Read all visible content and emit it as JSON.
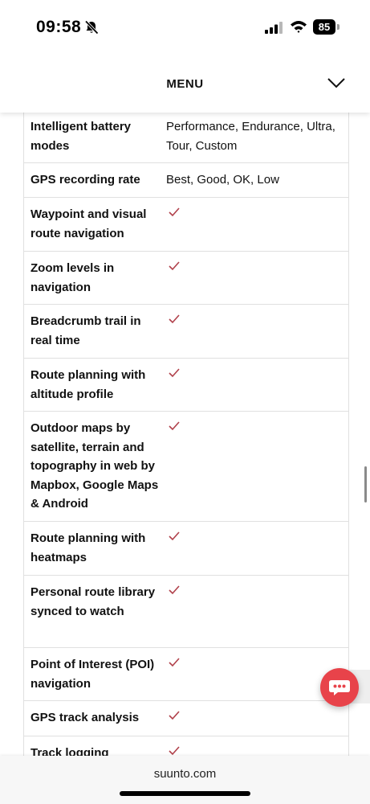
{
  "status_bar": {
    "time": "09:58",
    "battery_level": "85",
    "icons": [
      "bell-muted-icon",
      "cellular-signal-icon",
      "wifi-icon",
      "battery-icon"
    ]
  },
  "menu": {
    "label": "MENU",
    "toggle_icon": "chevron-down-icon"
  },
  "features": [
    {
      "label": "Intelligent battery modes",
      "value": "Performance, Endurance, Ultra, Tour, Custom",
      "check": false
    },
    {
      "label": "GPS recording rate",
      "value": "Best, Good, OK, Low",
      "check": false
    },
    {
      "label": "Waypoint and visual route navigation",
      "value": "",
      "check": true
    },
    {
      "label": "Zoom levels in navigation",
      "value": "",
      "check": true
    },
    {
      "label": "Breadcrumb trail in real time",
      "value": "",
      "check": true
    },
    {
      "label": "Route planning with altitude profile",
      "value": "",
      "check": true
    },
    {
      "label": "Outdoor maps by satellite, terrain and topography in web by Mapbox, Google Maps & Android",
      "value": "",
      "check": true
    },
    {
      "label": "Route planning with heatmaps",
      "value": "",
      "check": true
    },
    {
      "label": "Personal route library synced to watch",
      "value": "",
      "check": true
    },
    {
      "label": "Point of Interest (POI) navigation",
      "value": "",
      "check": true
    },
    {
      "label": "GPS track analysis",
      "value": "",
      "check": true
    },
    {
      "label": "Track logging",
      "value": "",
      "check": true
    }
  ],
  "check_color": "#b0404a",
  "chat": {
    "icon": "chat-bubble-icon",
    "color": "#e8434a"
  },
  "browser": {
    "url": "suunto.com"
  }
}
